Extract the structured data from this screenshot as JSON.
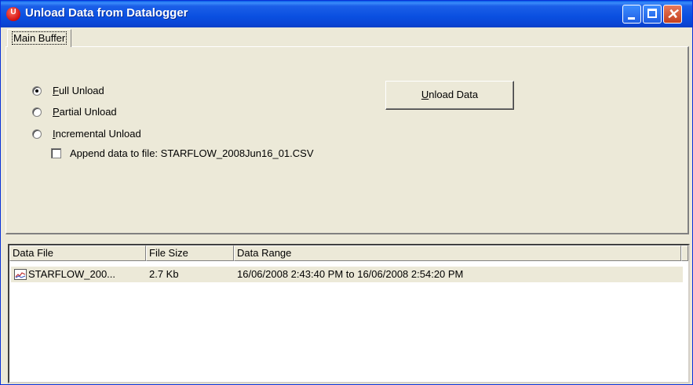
{
  "window": {
    "title": "Unload Data from Datalogger",
    "app_icon_letter": "U"
  },
  "tabs": [
    {
      "label": "Main Buffer"
    }
  ],
  "options": {
    "full": {
      "label_underline": "F",
      "label_rest": "ull Unload",
      "selected": true
    },
    "partial": {
      "label_underline": "P",
      "label_rest": "artial Unload",
      "selected": false
    },
    "incremental": {
      "label_underline": "I",
      "label_rest": "ncremental Unload",
      "selected": false
    },
    "append": {
      "label": "Append data to file: STARFLOW_2008Jun16_01.CSV",
      "checked": false
    }
  },
  "unload_button": {
    "label_underline": "U",
    "label_rest": "nload Data"
  },
  "table": {
    "columns": [
      "Data File",
      "File Size",
      "Data Range"
    ],
    "rows": [
      {
        "file": "STARFLOW_200...",
        "size": "2.7 Kb",
        "range": "16/06/2008 2:43:40 PM  to  16/06/2008 2:54:20 PM",
        "icon": "chart-file-icon"
      }
    ]
  },
  "colors": {
    "titlebar": "#0a4fe0",
    "face": "#ece9d8",
    "close": "#c4401f"
  }
}
